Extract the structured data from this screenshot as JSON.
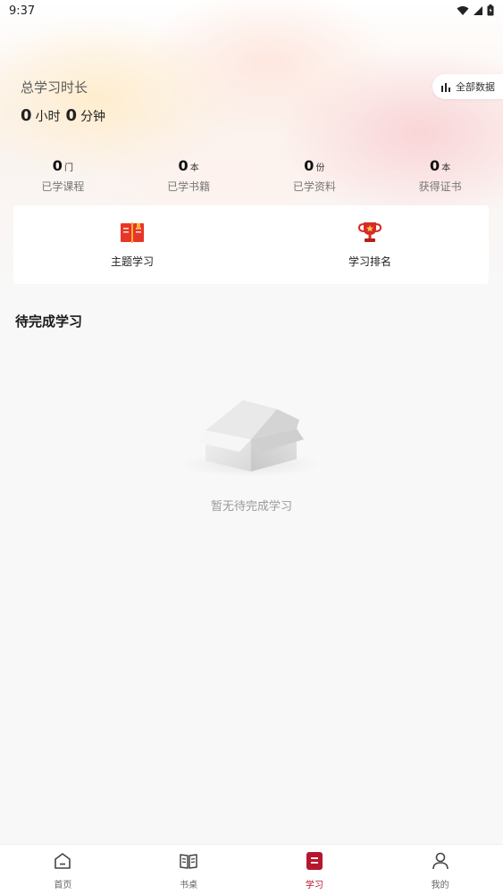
{
  "status_bar": {
    "time": "9:37",
    "icons": [
      "wifi-icon",
      "signal-icon",
      "battery-icon"
    ]
  },
  "summary": {
    "label": "总学习时长",
    "hours": "0",
    "hours_unit": "小时",
    "minutes": "0",
    "minutes_unit": "分钟",
    "all_data_label": "全部数据"
  },
  "stats": [
    {
      "value": "0",
      "unit": "门",
      "label": "已学课程"
    },
    {
      "value": "0",
      "unit": "本",
      "label": "已学书籍"
    },
    {
      "value": "0",
      "unit": "份",
      "label": "已学资料"
    },
    {
      "value": "0",
      "unit": "本",
      "label": "获得证书"
    }
  ],
  "quick_actions": [
    {
      "label": "主题学习",
      "icon": "book-icon"
    },
    {
      "label": "学习排名",
      "icon": "trophy-icon"
    }
  ],
  "pending": {
    "title": "待完成学习",
    "empty_text": "暂无待完成学习"
  },
  "tabs": [
    {
      "label": "首页",
      "icon": "home-icon",
      "active": false
    },
    {
      "label": "书桌",
      "icon": "open-book-icon",
      "active": false
    },
    {
      "label": "学习",
      "icon": "study-icon",
      "active": true
    },
    {
      "label": "我的",
      "icon": "user-icon",
      "active": false
    }
  ],
  "colors": {
    "accent": "#b5172e",
    "background": "#f8f8f8"
  }
}
